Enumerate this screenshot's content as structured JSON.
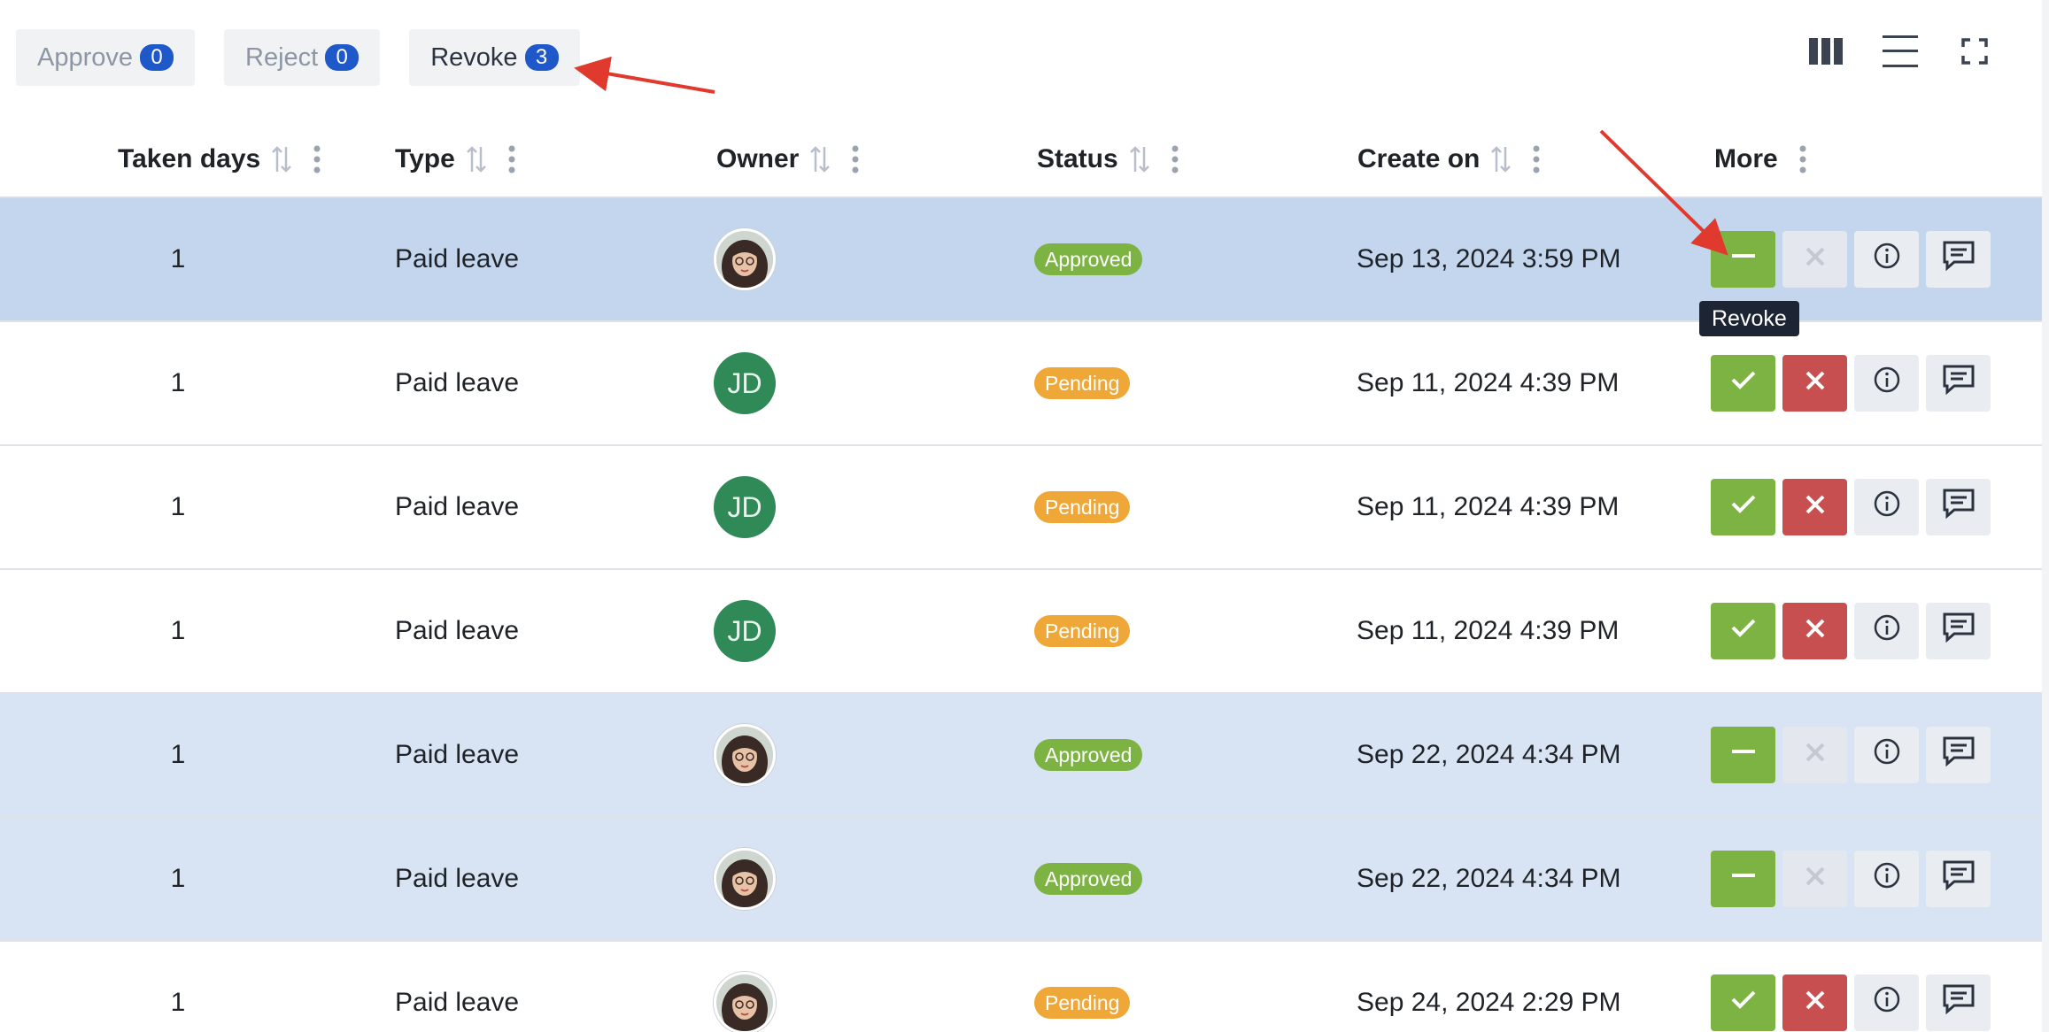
{
  "toolbar": {
    "buttons": [
      {
        "label": "Approve",
        "count": "0"
      },
      {
        "label": "Reject",
        "count": "0"
      },
      {
        "label": "Revoke",
        "count": "3"
      }
    ]
  },
  "view_icons": [
    "columns-icon",
    "list-icon",
    "fullscreen-icon"
  ],
  "table": {
    "headers": [
      "Taken days",
      "Type",
      "Owner",
      "Status",
      "Create on",
      "More"
    ],
    "rows": [
      {
        "days": "1",
        "type": "Paid leave",
        "owner": "photo",
        "status": "Approved",
        "created": "Sep 13, 2024 3:59 PM",
        "state": "selected"
      },
      {
        "days": "1",
        "type": "Paid leave",
        "owner": "JD",
        "status": "Pending",
        "created": "Sep 11, 2024 4:39 PM",
        "state": "normal"
      },
      {
        "days": "1",
        "type": "Paid leave",
        "owner": "JD",
        "status": "Pending",
        "created": "Sep 11, 2024 4:39 PM",
        "state": "normal"
      },
      {
        "days": "1",
        "type": "Paid leave",
        "owner": "JD",
        "status": "Pending",
        "created": "Sep 11, 2024 4:39 PM",
        "state": "normal"
      },
      {
        "days": "1",
        "type": "Paid leave",
        "owner": "photo",
        "status": "Approved",
        "created": "Sep 22, 2024 4:34 PM",
        "state": "highlighted"
      },
      {
        "days": "1",
        "type": "Paid leave",
        "owner": "photo",
        "status": "Approved",
        "created": "Sep 22, 2024 4:34 PM",
        "state": "highlighted"
      },
      {
        "days": "1",
        "type": "Paid leave",
        "owner": "photo",
        "status": "Pending",
        "created": "Sep 24, 2024 2:29 PM",
        "state": "normal"
      }
    ]
  },
  "tooltip": {
    "text": "Revoke"
  },
  "colors": {
    "approve_green": "#7cb342",
    "reject_red": "#c84f4f",
    "pending_orange": "#efa737",
    "count_blue": "#1f58c8",
    "selected_row": "#c4d6ee",
    "annotation_arrow": "#e03a2f"
  }
}
